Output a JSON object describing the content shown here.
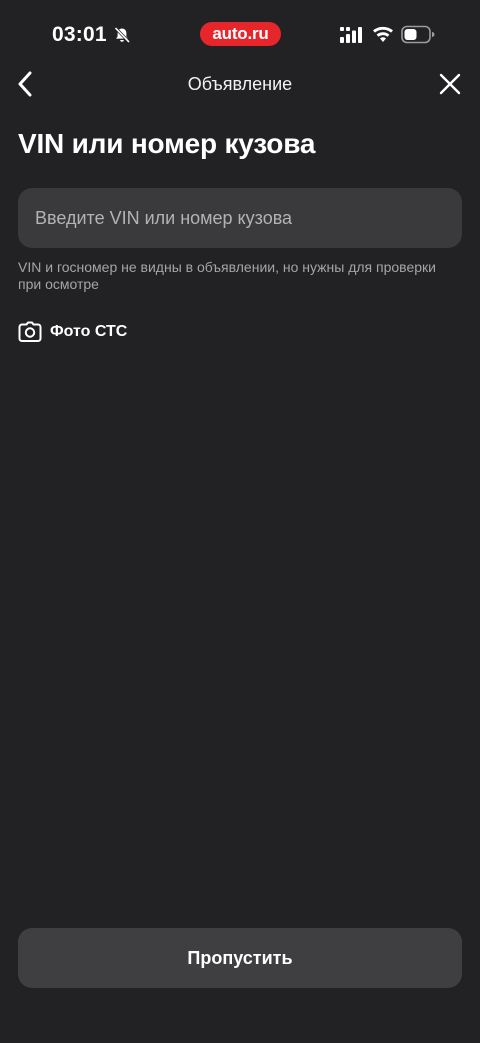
{
  "status_bar": {
    "time": "03:01",
    "brand": "auto.ru",
    "brand_color": "#e6262b",
    "icons": [
      "bell-off-icon",
      "signal-icon",
      "wifi-icon",
      "battery-icon"
    ]
  },
  "nav": {
    "title": "Объявление",
    "back_icon": "chevron-left-icon",
    "close_icon": "close-icon"
  },
  "main": {
    "title": "VIN или номер кузова",
    "vin_input": {
      "value": "",
      "placeholder": "Введите VIN или номер кузова"
    },
    "hint": "VIN и госномер не видны в объявлении, но нужны для проверки при осмотре",
    "photo_link": {
      "icon": "camera-icon",
      "label": "Фото СТС"
    }
  },
  "footer": {
    "skip_label": "Пропустить"
  },
  "colors": {
    "background": "#222124",
    "input_bg": "#3a393c",
    "button_bg": "#3f3e41",
    "hint_text": "#a5a4a8"
  }
}
